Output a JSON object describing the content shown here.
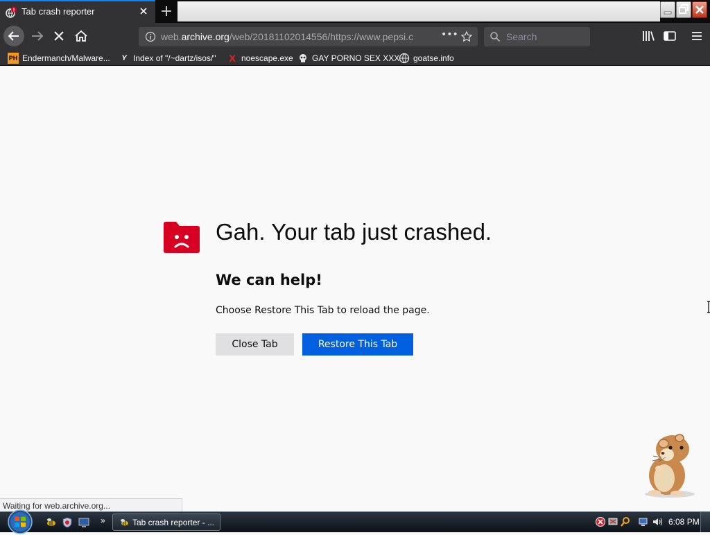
{
  "tab": {
    "title": "Tab crash reporter",
    "close_label": "×"
  },
  "navbar": {
    "url_prefix": "web.",
    "url_domain": "archive.org",
    "url_rest": "/web/20181102014556/https://www.pepsi.c",
    "page_actions": "•••",
    "search_placeholder": "Search"
  },
  "bookmarks": [
    {
      "label": "Endermanch/Malware...",
      "icon": "PH"
    },
    {
      "label": "Index of \"/~dartz/isos/\"",
      "icon": "Y"
    },
    {
      "label": "noescape.exe",
      "icon": "X"
    },
    {
      "label": "GAY PORNO SEX XXX",
      "icon": "skull-icon"
    },
    {
      "label": "goatse.info",
      "icon": "globe-icon"
    }
  ],
  "content": {
    "title": "Gah. Your tab just crashed.",
    "help_heading": "We can help!",
    "help_text": "Choose Restore This Tab to reload the page.",
    "close_tab_label": "Close Tab",
    "restore_tab_label": "Restore This Tab"
  },
  "status_text": "Waiting for web.archive.org...",
  "taskbar": {
    "task_label": "Tab crash reporter - ...",
    "overflow_label": "»",
    "clock": "6:08 PM"
  },
  "colors": {
    "accent": "#0a84ff",
    "restore_button": "#0060df",
    "crash_icon": "#d70022",
    "toolbar_dark": "#323234"
  }
}
